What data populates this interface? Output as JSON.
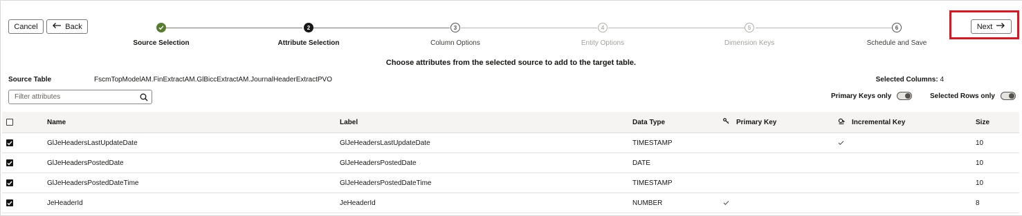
{
  "toolbar": {
    "cancel_label": "Cancel",
    "back_label": "Back",
    "next_label": "Next"
  },
  "steps": [
    {
      "number": "",
      "label": "Source Selection",
      "state": "completed"
    },
    {
      "number": "2",
      "label": "Attribute Selection",
      "state": "current"
    },
    {
      "number": "3",
      "label": "Column Options",
      "state": "enabled"
    },
    {
      "number": "4",
      "label": "Entity Options",
      "state": "disabled"
    },
    {
      "number": "5",
      "label": "Dimension Keys",
      "state": "disabled"
    },
    {
      "number": "6",
      "label": "Schedule and Save",
      "state": "enabled"
    }
  ],
  "instruction": "Choose attributes from the selected source to add to the target table.",
  "source": {
    "label": "Source Table",
    "value": "FscmTopModelAM.FinExtractAM.GlBiccExtractAM.JournalHeaderExtractPVO"
  },
  "selected_columns": {
    "label": "Selected Columns:",
    "count": "4"
  },
  "filter": {
    "placeholder": "Filter attributes",
    "value": ""
  },
  "toggles": {
    "primary_keys_label": "Primary Keys only",
    "primary_keys_on": false,
    "selected_rows_label": "Selected Rows only",
    "selected_rows_on": false
  },
  "table": {
    "headers": {
      "name": "Name",
      "label": "Label",
      "data_type": "Data Type",
      "primary_key": "Primary Key",
      "incremental_key": "Incremental Key",
      "size": "Size"
    },
    "rows": [
      {
        "checked": true,
        "name": "GlJeHeadersLastUpdateDate",
        "label": "GlJeHeadersLastUpdateDate",
        "data_type": "TIMESTAMP",
        "primary_key": false,
        "incremental_key": true,
        "size": "10"
      },
      {
        "checked": true,
        "name": "GlJeHeadersPostedDate",
        "label": "GlJeHeadersPostedDate",
        "data_type": "DATE",
        "primary_key": false,
        "incremental_key": false,
        "size": "10"
      },
      {
        "checked": true,
        "name": "GlJeHeadersPostedDateTime",
        "label": "GlJeHeadersPostedDateTime",
        "data_type": "TIMESTAMP",
        "primary_key": false,
        "incremental_key": false,
        "size": "10"
      },
      {
        "checked": true,
        "name": "JeHeaderId",
        "label": "JeHeaderId",
        "data_type": "NUMBER",
        "primary_key": true,
        "incremental_key": false,
        "size": "8"
      }
    ]
  },
  "colors": {
    "completed_step": "#567d2e",
    "current_step": "#1a1816",
    "highlight_box": "#e3121f"
  }
}
